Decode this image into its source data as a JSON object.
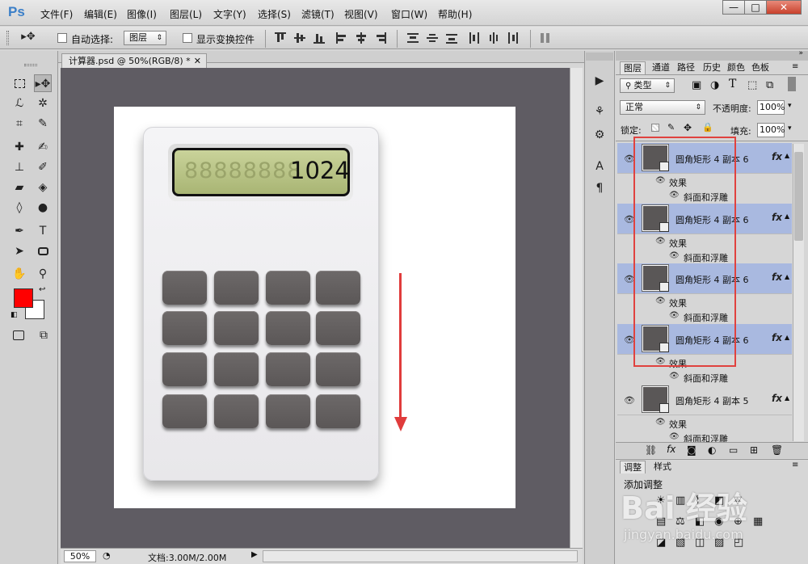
{
  "app": {
    "logo": "Ps"
  },
  "menu": [
    "文件(F)",
    "编辑(E)",
    "图像(I)",
    "图层(L)",
    "文字(Y)",
    "选择(S)",
    "滤镜(T)",
    "视图(V)",
    "窗口(W)",
    "帮助(H)"
  ],
  "window_controls": {
    "minimize": "—",
    "maximize": "□",
    "close": "✕"
  },
  "options": {
    "auto_select_label": "自动选择:",
    "auto_select_value": "图层",
    "show_transform_label": "显示变换控件"
  },
  "document": {
    "tab_title": "计算器.psd @ 50%(RGB/8) *",
    "zoom": "50%",
    "doc_size": "文档:3.00M/2.00M"
  },
  "calculator": {
    "ghost_digits": "88888888",
    "display_value": "1024"
  },
  "panel_tabs": [
    "图层",
    "通道",
    "路径",
    "历史",
    "颜色",
    "色板"
  ],
  "layers_panel": {
    "kind_filter": "类型",
    "blend_mode": "正常",
    "opacity_label": "不透明度:",
    "opacity_value": "100%",
    "lock_label": "锁定:",
    "fill_label": "填充:",
    "fill_value": "100%",
    "layers": [
      {
        "name": "圆角矩形 4 副本 6",
        "fx": "fx",
        "effects_label": "效果",
        "effect": "斜面和浮雕"
      },
      {
        "name": "圆角矩形 4 副本 6",
        "fx": "fx",
        "effects_label": "效果",
        "effect": "斜面和浮雕"
      },
      {
        "name": "圆角矩形 4 副本 6",
        "fx": "fx",
        "effects_label": "效果",
        "effect": "斜面和浮雕"
      },
      {
        "name": "圆角矩形 4 副本 6",
        "fx": "fx",
        "effects_label": "效果",
        "effect": "斜面和浮雕"
      },
      {
        "name": "圆角矩形 4 副本 5",
        "fx": "fx",
        "effects_label": "效果",
        "effect": "斜面和浮雕"
      }
    ]
  },
  "adjust_tabs": [
    "调整",
    "样式"
  ],
  "adjust_title": "添加调整",
  "watermark": {
    "brand": "Bai 经验",
    "url": "jingyan.baidu.com"
  },
  "colors": {
    "foreground": "#ff0000",
    "background": "#ffffff",
    "annotation": "#e0423f"
  }
}
